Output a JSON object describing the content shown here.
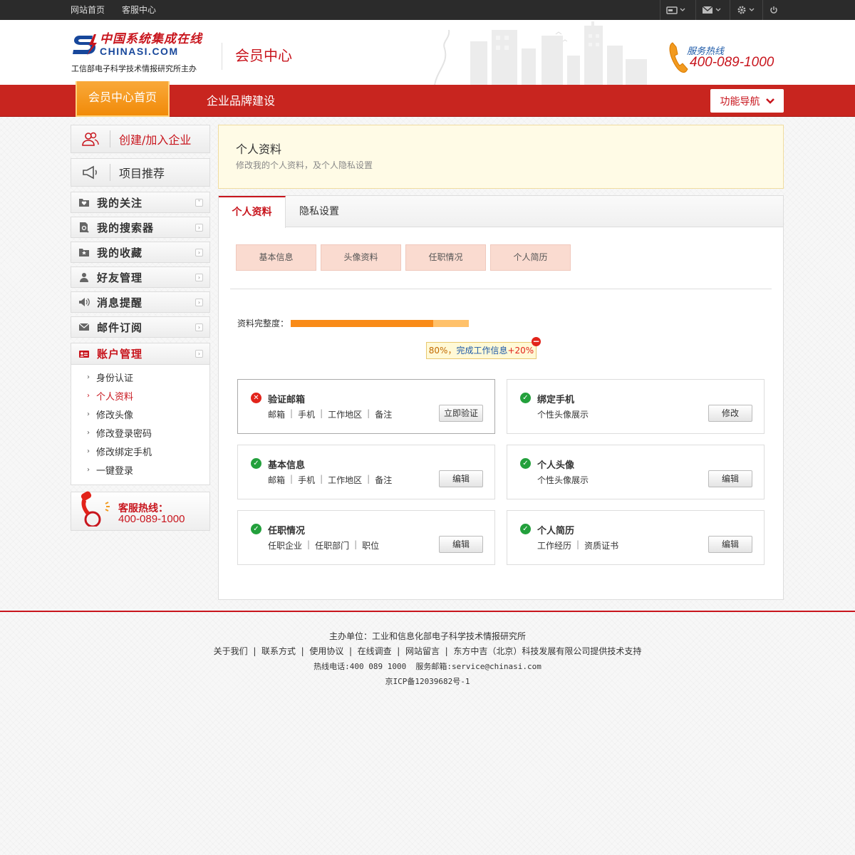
{
  "topbar": {
    "home": "网站首页",
    "service": "客服中心"
  },
  "header": {
    "logo_cn": "中国系统集成在线",
    "logo_en": "CHINASI.COM",
    "logo_sub": "工信部电子科学技术情报研究所主办",
    "title": "会员中心",
    "hotline_label": "服务热线",
    "hotline_number": "400-089-1000"
  },
  "nav": {
    "home": "会员中心首页",
    "brand": "企业品牌建设",
    "func": "功能导航"
  },
  "sidebar": {
    "create_join": "创建/加入企业",
    "projects": "项目推荐",
    "menu": [
      {
        "label": "我的关注",
        "icon": "heart-folder-icon",
        "arrow": "˅"
      },
      {
        "label": "我的搜索器",
        "icon": "search-doc-icon",
        "arrow": "›"
      },
      {
        "label": "我的收藏",
        "icon": "star-folder-icon",
        "arrow": "›"
      },
      {
        "label": "好友管理",
        "icon": "user-icon",
        "arrow": "›"
      },
      {
        "label": "消息提醒",
        "icon": "speaker-icon",
        "arrow": "›"
      },
      {
        "label": "邮件订阅",
        "icon": "mail-icon",
        "arrow": "›"
      }
    ],
    "account": {
      "label": "账户管理",
      "arrow": "›",
      "subs": [
        "身份认证",
        "个人资料",
        "修改头像",
        "修改登录密码",
        "修改绑定手机",
        "一键登录"
      ]
    },
    "hotline_label": "客服热线：",
    "hotline_number": "400-089-1000"
  },
  "profile": {
    "title": "个人资料",
    "subtitle": "修改我的个人资料，及个人隐私设置"
  },
  "tabs": [
    "个人资料",
    "隐私设置"
  ],
  "sections": [
    "基本信息",
    "头像资料",
    "任职情况",
    "个人简历"
  ],
  "completion": {
    "label": "资料完整度：",
    "percent": 80,
    "tip_prefix": "80%，",
    "tip_link": "完成工作信息",
    "tip_bonus": "+20%"
  },
  "cards": [
    {
      "title": "验证邮箱",
      "status": "bad",
      "items": [
        "邮箱",
        "手机",
        "工作地区",
        "备注"
      ],
      "button": "立即验证"
    },
    {
      "title": "绑定手机",
      "status": "ok",
      "items": [
        "个性头像展示"
      ],
      "button": "修改"
    },
    {
      "title": "基本信息",
      "status": "ok",
      "items": [
        "邮箱",
        "手机",
        "工作地区",
        "备注"
      ],
      "button": "编辑"
    },
    {
      "title": "个人头像",
      "status": "ok",
      "items": [
        "个性头像展示"
      ],
      "button": "编辑"
    },
    {
      "title": "任职情况",
      "status": "ok",
      "items": [
        "任职企业",
        "任职部门",
        "职位"
      ],
      "button": "编辑"
    },
    {
      "title": "个人简历",
      "status": "ok",
      "items": [
        "工作经历",
        "资质证书"
      ],
      "button": "编辑"
    }
  ],
  "footer": {
    "host": "主办单位：工业和信息化部电子科学技术情报研究所",
    "links": [
      "关于我们",
      "联系方式",
      "使用协议",
      "在线调查",
      "网站留言",
      "东方中吉（北京）科技发展有限公司提供技术支持"
    ],
    "contact": "热线电话:400 089 1000  服务邮箱:service@chinasi.com",
    "icp": "京ICP备12039682号-1"
  },
  "colors": {
    "brand_red": "#c8151d",
    "nav_red": "#c8251f",
    "orange": "#f98b18",
    "ok_green": "#23a03c"
  }
}
